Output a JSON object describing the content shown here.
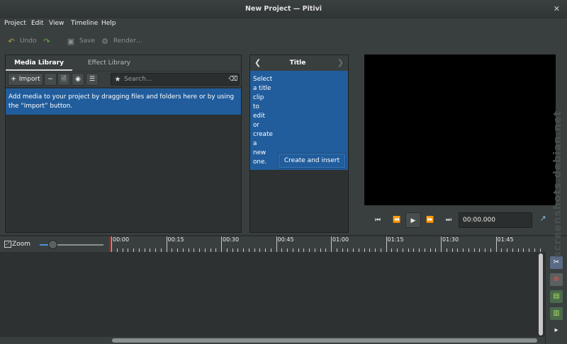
{
  "window": {
    "title": "New Project — Pitivi",
    "close_glyph": "✕"
  },
  "menu": [
    "Project",
    "Edit",
    "View",
    "Timeline",
    "Help"
  ],
  "toolbar": {
    "undo": "Undo",
    "redo_icon": "redo-icon",
    "save": "Save",
    "render": "Render…"
  },
  "library": {
    "tabs": [
      "Media Library",
      "Effect Library"
    ],
    "import_label": "Import",
    "search_placeholder": "Search...",
    "info": "Add media to your project by dragging files and folders here or by using the “Import” button."
  },
  "title_panel": {
    "header": "Title",
    "message_words": [
      "Select",
      "a title",
      "clip",
      "to",
      "edit",
      "or",
      "create",
      "a",
      "new",
      "one."
    ],
    "create_button": "Create and insert"
  },
  "viewer": {
    "timecode": "00:00.000"
  },
  "timeline": {
    "zoom_label": "Zoom",
    "ruler_labels": [
      "00:00",
      "00:15",
      "00:30",
      "00:45",
      "01:00",
      "01:15",
      "01:30",
      "01:45"
    ]
  },
  "watermark": "screenshots.debian.net",
  "colors": {
    "accent": "#215d9c",
    "background": "#393f3f",
    "panel": "#2d3131",
    "viewer": "#000000",
    "playhead": "#cc3333"
  }
}
